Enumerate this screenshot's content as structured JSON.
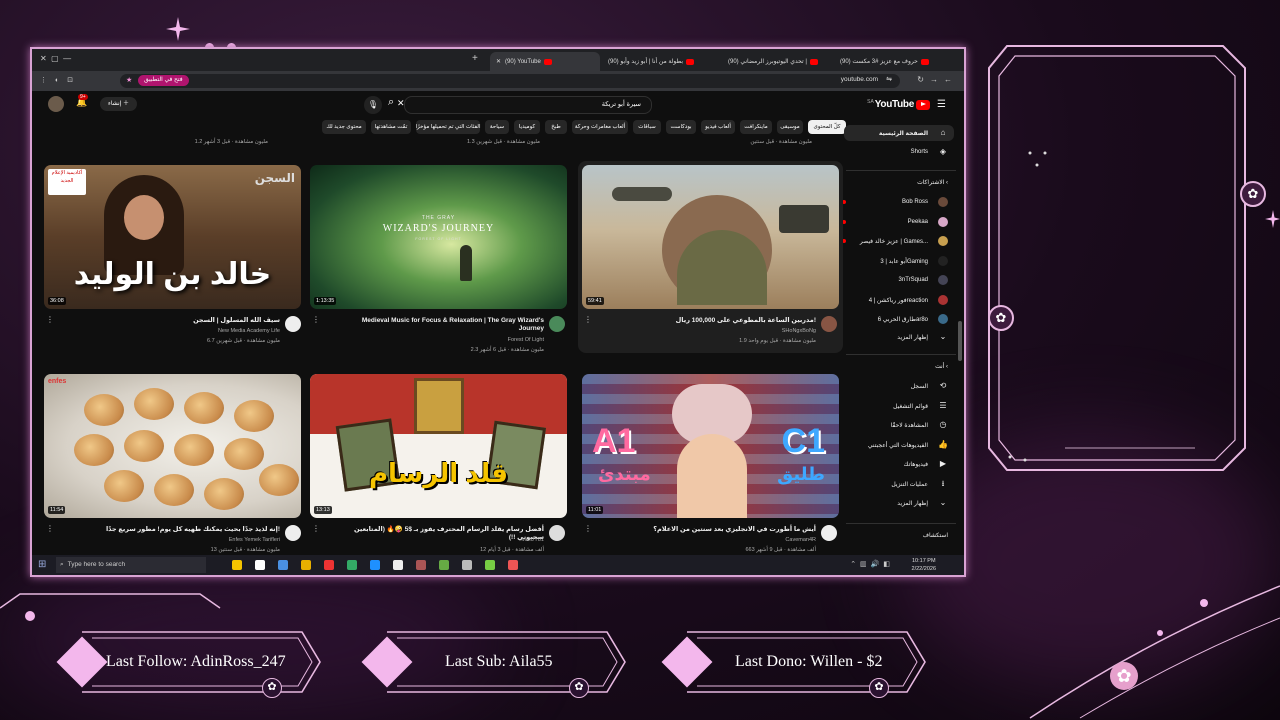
{
  "browser": {
    "tabs": [
      {
        "label": "(90) YouTube",
        "active": true
      },
      {
        "label": "(90) بطولة من أنا | أبو زيد وأبو"
      },
      {
        "label": "(90) تحدي اليوتيوبرز الرمضاني |"
      },
      {
        "label": "(90) حروف مع عزيز #3 مكست"
      }
    ],
    "url": "youtube.com",
    "open_in_app": "فتح في التطبيق"
  },
  "youtube": {
    "logo": "YouTube",
    "region": "SA",
    "search_value": "سيرة أبو تريكة",
    "create_label": "إنشاء",
    "notifications": "9+",
    "chips": [
      "كلّ المحتوى",
      "موسيقى",
      "ماينكرافت",
      "ألعاب فيديو",
      "بودكاست",
      "سباقات",
      "ألعاب مغامرات وحركة",
      "طبخ",
      "كوميديا",
      "سياحة",
      "الفئات التي تم تحميلها مؤخرًا",
      "تمّت مشاهدتها",
      "محتوى جديد لك"
    ],
    "sidebar": {
      "home": "الصفحة الرئيسية",
      "shorts": "Shorts",
      "subs_header": "الاشتراكات",
      "subs": [
        "Bob Ross",
        "Peekaa",
        "عزيز خالد فيصر | Games...",
        "أبو عابد | 3Gaming",
        "3nTrSquad",
        "فور رياكشن | 4reaction",
        "طارق الحربي 6ar8o"
      ],
      "show_more": "إظهار المزيد",
      "you_header": "أنت",
      "you_items": [
        "السجل",
        "قوائم التشغيل",
        "المشاهدة لاحقًا",
        "الفيديوهات التي أعجبتني",
        "فيديوهاتك",
        "عمليات التنزيل",
        "إظهار المزيد"
      ],
      "explore": "استكشاف"
    },
    "top_row_meta": [
      "1.2 مليون مشاهدة · قبل 3 أشهر",
      "1.3 مليون مشاهدة · قبل شهرين",
      "مليون مشاهدة · قبل سنتين"
    ],
    "videos": [
      {
        "title": "سيف الله المسلول | السجن",
        "channel": "New Media Academy Life",
        "meta": "6.7 مليون مشاهدة · قبل شهرين",
        "duration": "36:08",
        "thumb_text": "خالد بن الوليد",
        "badge": "السجن",
        "logo_text": "أكاديمية الإعلام الجديد"
      },
      {
        "title": "Medieval Music for Focus & Relaxation | The Gray Wizard's Journey",
        "channel": "Forest Of Light",
        "meta": "2.3 مليون مشاهدة · قبل 6 أشهر",
        "duration": "1:13:35",
        "thumb_text_top": "THE GRAY",
        "thumb_text": "WIZARD'S JOURNEY",
        "thumb_text_sub": "FOREST OF LIGHT"
      },
      {
        "title": "مدربين الساعة بالمطوعي على 100,000 ريال!",
        "channel": "SHoNgxBoNg",
        "meta": "1.9 مليون مشاهدة · قبل يوم واحد",
        "duration": "59:41"
      },
      {
        "title": "إنه لذيذ جدًا بحيث يمكنك طهيه كل يوم! مطور سريع جدًا!",
        "channel": "Enfes Yemek Tarifleri",
        "meta": "13 مليون مشاهدة · قبل سنتين",
        "duration": "11:54",
        "brand": "enfes"
      },
      {
        "title": "أفضل رسام يقلد الرسام المحترف يفوز بـ $5 🤪🔥 (المتابعين سحبوني !!)",
        "channel": "MODY81",
        "meta": "12 ألف مشاهدة · قبل 3 أيام",
        "duration": "13:13",
        "thumb_text": "قلد الرسام"
      },
      {
        "title": "أيش ما أطورت في الانجليزي بعد سنتين من الاعلام؟",
        "channel": "Caveman4R",
        "meta": "663 ألف مشاهدة · قبل 9 أشهر",
        "duration": "11:01",
        "left_badge": "A1",
        "left_word": "مبتدئ",
        "right_badge": "C1",
        "right_word": "طليق"
      }
    ]
  },
  "taskbar": {
    "search_placeholder": "Type here to search",
    "time": "10:17 PM",
    "date": "2/22/2026"
  },
  "overlay": {
    "last_follow": "Last Follow: AdinRoss_247",
    "last_sub": "Last Sub: Aila55",
    "last_dono": "Last Dono: Willen - $2"
  },
  "colors": {
    "accent": "#e7a6dd",
    "yt_red": "#ff0000",
    "bg": "#1a0b1c"
  }
}
